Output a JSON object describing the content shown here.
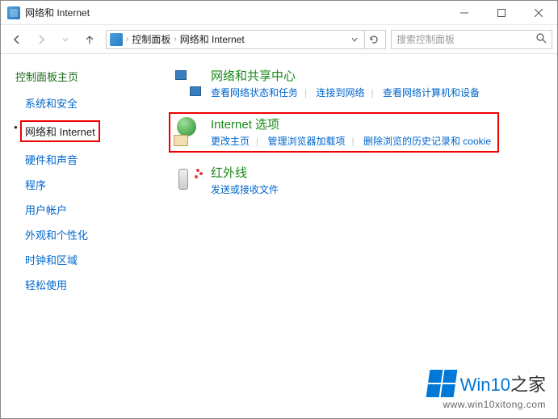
{
  "window": {
    "title": "网络和 Internet"
  },
  "breadcrumb": {
    "item1": "控制面板",
    "item2": "网络和 Internet"
  },
  "search": {
    "placeholder": "搜索控制面板"
  },
  "sidebar": {
    "home": "控制面板主页",
    "items": [
      {
        "label": "系统和安全"
      },
      {
        "label": "网络和 Internet"
      },
      {
        "label": "硬件和声音"
      },
      {
        "label": "程序"
      },
      {
        "label": "用户帐户"
      },
      {
        "label": "外观和个性化"
      },
      {
        "label": "时钟和区域"
      },
      {
        "label": "轻松使用"
      }
    ]
  },
  "content": {
    "sections": [
      {
        "title": "网络和共享中心",
        "links": [
          "查看网络状态和任务",
          "连接到网络",
          "查看网络计算机和设备"
        ]
      },
      {
        "title": "Internet 选项",
        "links": [
          "更改主页",
          "管理浏览器加载项",
          "删除浏览的历史记录和 cookie"
        ]
      },
      {
        "title": "红外线",
        "links": [
          "发送或接收文件"
        ]
      }
    ]
  },
  "watermark": {
    "brand_a": "Win10",
    "brand_b": "之家",
    "url": "www.win10xitong.com"
  }
}
